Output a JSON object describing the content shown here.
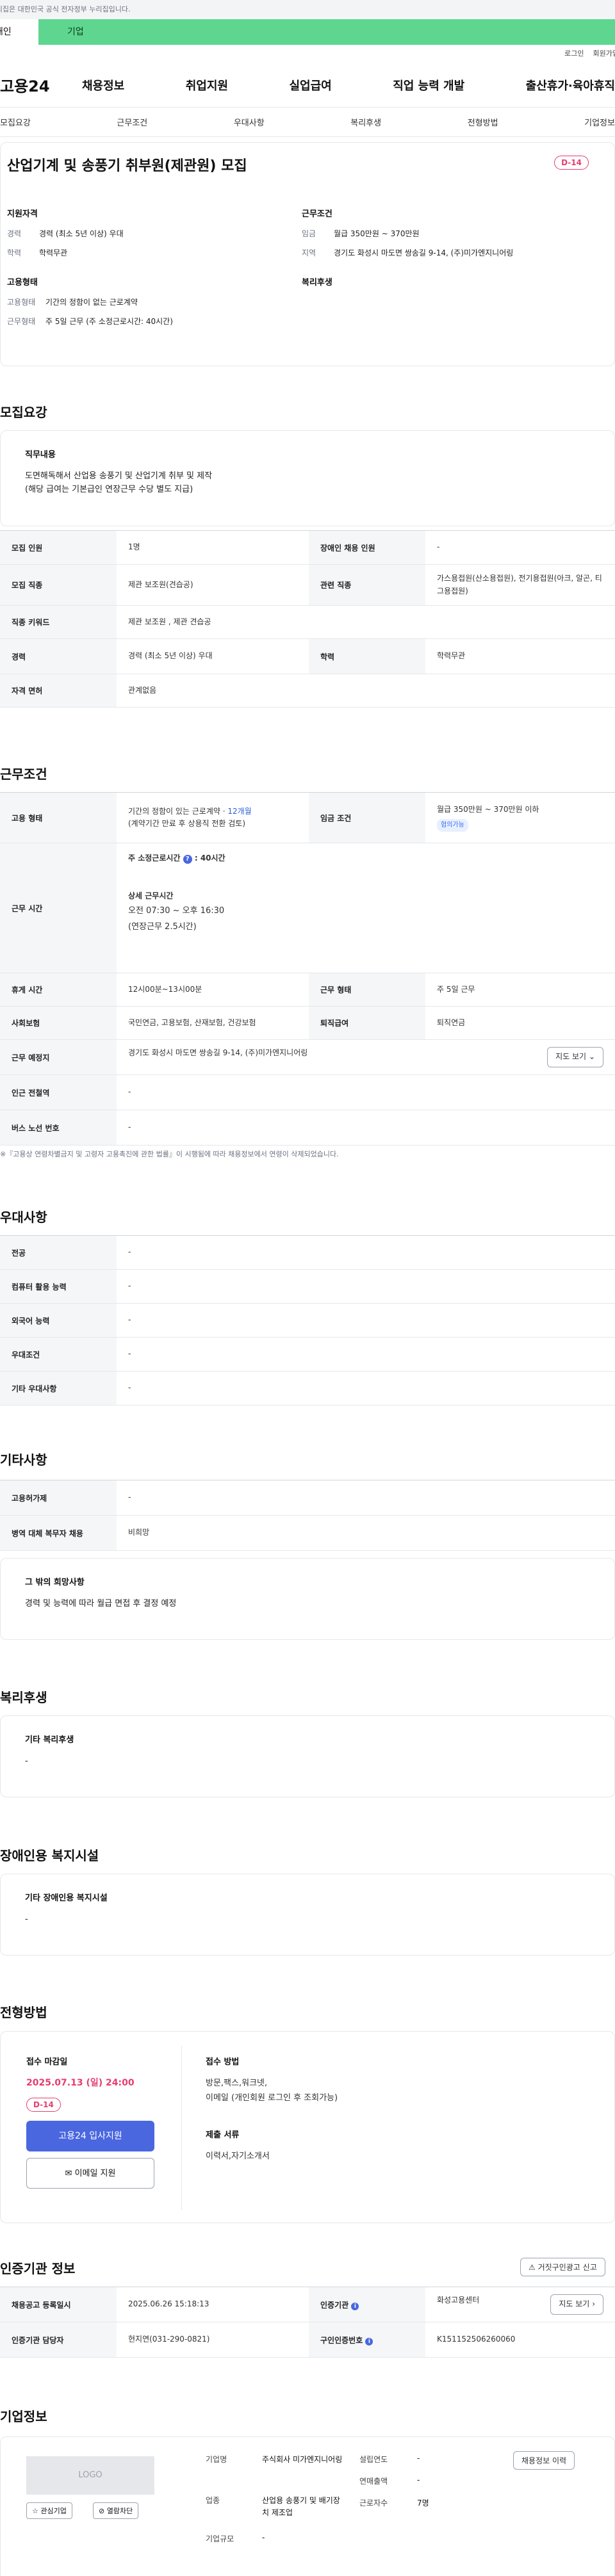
{
  "gov_bar": {
    "text": "이 누리집은 대한민국 공식 전자정부 누리집입니다."
  },
  "top_tabs": {
    "individual": "개인",
    "corporate": "기업"
  },
  "util": {
    "login": "로그인",
    "signup": "회원가입"
  },
  "gnb": {
    "logo": "고용24",
    "menu": [
      "채용정보",
      "취업지원",
      "실업급여",
      "직업 능력 개발",
      "출산휴가·육아휴직"
    ]
  },
  "anchor_tabs": [
    "모집요강",
    "근무조건",
    "우대사항",
    "복리후생",
    "전형방법",
    "기업정보"
  ],
  "summary": {
    "title": "산업기계 및 송풍기 취부원(제관원) 모집",
    "dday": "D-14",
    "qual_title": "지원자격",
    "qual": [
      {
        "k": "경력",
        "v": "경력 (최소 5년 이상) 우대"
      },
      {
        "k": "학력",
        "v": "학력무관"
      }
    ],
    "cond_title": "근무조건",
    "cond": [
      {
        "k": "임금",
        "v": "월급 350만원 ~ 370만원"
      },
      {
        "k": "지역",
        "v": "경기도 화성시 마도면 쌍송길 9-14, (주)미가엔지니어링"
      }
    ],
    "emp_title": "고용형태",
    "emp": [
      {
        "k": "고용형태",
        "v": "기간의 정함이 없는 근로계약"
      },
      {
        "k": "근무형태",
        "v": "주 5일 근무 (주 소정근로시간: 40시간)"
      }
    ],
    "welfare_title": "복리후생"
  },
  "recruit": {
    "title": "모집요강",
    "duty_title": "직무내용",
    "duty_lines": [
      "도면해독해서 산업용 송풍기 및 산업기계 취부 및 제작",
      "(해당 급여는 기본급인 연장근무 수당 별도 지급)"
    ],
    "rows": [
      {
        "k1": "모집 인원",
        "v1": "1명",
        "k2": "장애인 채용 인원",
        "v2": "-"
      },
      {
        "k1": "모집 직종",
        "v1": "제관 보조원(견습공)",
        "k2": "관련 직종",
        "v2": "가스용접원(산소용접원), 전기용접원(아크, 알곤, 티그용접원)"
      },
      {
        "k1": "직종 키워드",
        "v1": "제관 보조원 , 제관 견습공"
      },
      {
        "k1": "경력",
        "v1": "경력 (최소 5년 이상) 우대",
        "k2": "학력",
        "v2": "학력무관"
      },
      {
        "k1": "자격 면허",
        "v1": "관계없음"
      }
    ]
  },
  "conditions": {
    "title": "근무조건",
    "employ_k": "고용 형태",
    "employ_v1": "기간의 정함이 있는 근로계약 · ",
    "employ_period": "12개월",
    "employ_v2": "(계약기간 만료 후 상용직 전환 검토)",
    "wage_k": "임금 조건",
    "wage_v": "월급 350만원 ~ 370만원 이하",
    "wage_badge": "협의가능",
    "hours_k": "근무 시간",
    "hours_main": "주 소정근로시간",
    "hours_val": ": 40시간",
    "hours_detail_title": "상세 근무시간",
    "hours_detail_1": "오전 07:30 ~ 오후 16:30",
    "hours_detail_2": "(연장근무 2.5시간)",
    "rest_k": "휴게 시간",
    "rest_v": "12시00분~13시00분",
    "work_type_k": "근무 형태",
    "work_type_v": "주 5일 근무",
    "insurance_k": "사회보험",
    "insurance_v": "국민연금, 고용보험, 산재보험, 건강보험",
    "retire_k": "퇴직급여",
    "retire_v": "퇴직연금",
    "place_k": "근무 예정지",
    "place_v": "경기도 화성시 마도면 쌍송길 9-14, (주)미가엔지니어링",
    "map_btn": "지도 보기",
    "subway_k": "인근 전철역",
    "subway_v": "-",
    "bus_k": "버스 노선 번호",
    "bus_v": "-",
    "note": "※『고용상 연령차별금지 및 고령자 고용촉진에 관한 법률』이 시행됨에 따라 채용정보에서 연령이 삭제되었습니다."
  },
  "pref": {
    "title": "우대사항",
    "rows": [
      {
        "k": "전공",
        "v": "-"
      },
      {
        "k": "컴퓨터 활용 능력",
        "v": "-"
      },
      {
        "k": "외국어 능력",
        "v": "-"
      },
      {
        "k": "우대조건",
        "v": "-"
      },
      {
        "k": "기타 우대사항",
        "v": "-"
      }
    ]
  },
  "etc": {
    "title": "기타사항",
    "rows": [
      {
        "k": "고용허가제",
        "v": "-"
      },
      {
        "k": "병역 대체 복무자 채용",
        "v": "비희망"
      }
    ],
    "other_title": "그 밖의 희망사항",
    "other_text": "경력 및 능력에 따라 월급 면접 후 결정 예정"
  },
  "welfare": {
    "title": "복리후생",
    "box_title": "기타 복리후생",
    "box_value": "-"
  },
  "disabled": {
    "title": "장애인용 복지시설",
    "box_title": "기타 장애인용 복지시설",
    "box_value": "-"
  },
  "screening": {
    "title": "전형방법",
    "deadline_label": "접수 마감일",
    "deadline": "2025.07.13 (일) 24:00",
    "dday": "D-14",
    "apply_btn": "고용24 입사지원",
    "email_btn": "이메일 지원",
    "method_label": "접수 방법",
    "method_lines": [
      "방문,팩스,워크넷,",
      "이메일 (개인회원 로그인 후 조회가능)"
    ],
    "docs_label": "제출 서류",
    "docs": "이력서,자기소개서"
  },
  "cert": {
    "title": "인증기관 정보",
    "report_btn": "거짓구인광고 신고",
    "rows": [
      {
        "k1": "채용공고 등록일시",
        "v1": "2025.06.26 15:18:13",
        "k2": "인증기관",
        "v2": "화성고용센터",
        "btn": "지도 보기"
      },
      {
        "k1": "인증기관 담당자",
        "v1": "현지연(031-290-0821)",
        "k2": "구인인증번호",
        "v2": "K151152506260060"
      }
    ]
  },
  "company": {
    "title": "기업정보",
    "logo_text": "LOGO",
    "interest_btn": "관심기업",
    "block_btn": "열람차단",
    "info_btn": "채용정보 이력",
    "fields": {
      "name_k": "기업명",
      "name_v": "주식회사 미가엔지니어링",
      "industry_k": "업종",
      "industry_v": "산업용 송풍기 및 배기장치 제조업",
      "size_k": "기업규모",
      "size_v": "-",
      "founded_k": "설립연도",
      "founded_v": "-",
      "revenue_k": "연매출액",
      "revenue_v": "-",
      "employees_k": "근로자수",
      "employees_v": "7명"
    }
  },
  "colors": {
    "accent_green": "#5ed68f",
    "dday_red": "#e53e6e",
    "primary_blue": "#4a67e0"
  }
}
